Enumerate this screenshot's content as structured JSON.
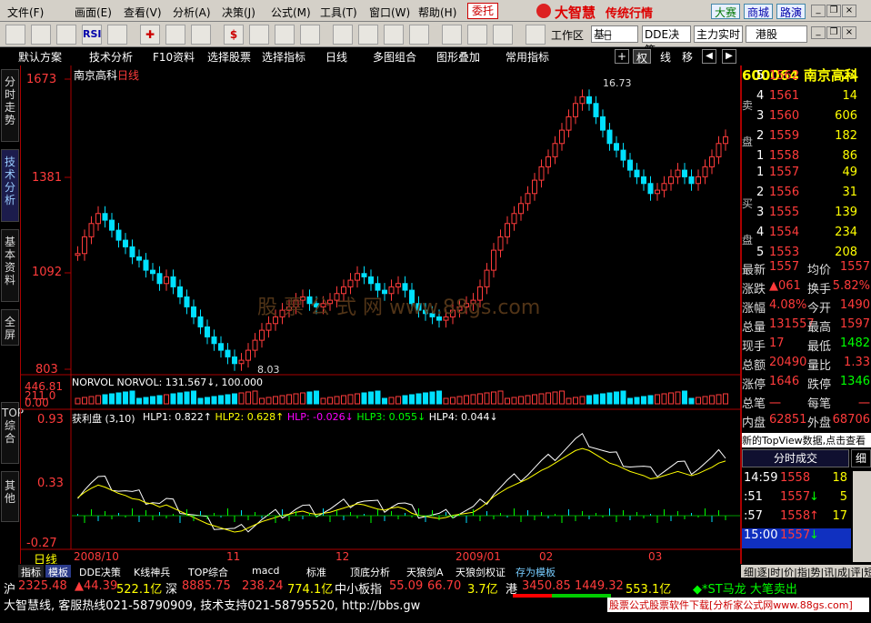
{
  "menu": {
    "items": [
      "文件(F)",
      "画面(E)",
      "查看(V)",
      "分析(A)",
      "决策(J)",
      "公式(M)",
      "工具(T)",
      "窗口(W)",
      "帮助(H)"
    ],
    "weituo": "委托",
    "brand": "大智慧",
    "brand_sub": "传统行情",
    "dasai": "大赛",
    "shangcheng": "商城",
    "luyou": "路演"
  },
  "toolbar": {
    "workspace": "工作区",
    "basic": "基本̶",
    "dde": "DDE决策",
    "main_live": "主力实时",
    "hk": "港股"
  },
  "tabs": [
    "默认方案",
    "技术分析",
    "F10资料",
    "选择股票",
    "选择指标",
    "日线",
    "多图组合",
    "图形叠加",
    "常用指标"
  ],
  "tab_right": {
    "right_tab": "权",
    "line": "线",
    "move": "移"
  },
  "left_tabs": [
    "分时走势",
    "技术分析",
    "基本资料",
    "全屏",
    "TOP综合",
    "其他"
  ],
  "chart": {
    "stock_name": "南京高科",
    "period": "日线",
    "price_axis": [
      "1673",
      "1381",
      "1092",
      "803"
    ],
    "high_label": "16.73",
    "low_label": "8.03",
    "vol_title": "NORVOL  NORVOL: 131.567↓, 100.000",
    "vol_axis": [
      "446.81",
      "211.0",
      "0.00"
    ],
    "ind_title": "获利盘 (3,10)",
    "ind_values": [
      {
        "label": "HLP1: 0.822↑",
        "color": "#ffffff"
      },
      {
        "label": "HLP2: 0.628↑",
        "color": "#ffff00"
      },
      {
        "label": "HLP: -0.026↓",
        "color": "#ff00ff"
      },
      {
        "label": "HLP3: 0.055↓",
        "color": "#00ff00"
      },
      {
        "label": "HLP4: 0.044↓",
        "color": "#ffffff"
      }
    ],
    "ind_axis": [
      "0.93",
      "0.33",
      "-0.27"
    ],
    "date_labels": [
      "2008/10",
      "11",
      "12",
      "2009/01",
      "02",
      "03"
    ],
    "period_tab": "日线",
    "watermark": "股 票 公 式 网 www.88gs.com"
  },
  "quote": {
    "code": "600064",
    "name": "南京高科",
    "sell_label": "卖盘",
    "buy_label": "买盘",
    "asks": [
      {
        "lvl": "5",
        "price": "1562",
        "vol": "24"
      },
      {
        "lvl": "4",
        "price": "1561",
        "vol": "14"
      },
      {
        "lvl": "3",
        "price": "1560",
        "vol": "606"
      },
      {
        "lvl": "2",
        "price": "1559",
        "vol": "182"
      },
      {
        "lvl": "1",
        "price": "1558",
        "vol": "86"
      }
    ],
    "bids": [
      {
        "lvl": "1",
        "price": "1557",
        "vol": "49"
      },
      {
        "lvl": "2",
        "price": "1556",
        "vol": "31"
      },
      {
        "lvl": "3",
        "price": "1555",
        "vol": "139"
      },
      {
        "lvl": "4",
        "price": "1554",
        "vol": "234"
      },
      {
        "lvl": "5",
        "price": "1553",
        "vol": "208"
      }
    ],
    "stats": [
      {
        "l": "最新",
        "v": "1557",
        "l2": "均价",
        "v2": "1557"
      },
      {
        "l": "涨跌",
        "v": "▲061",
        "l2": "换手",
        "v2": "5.82%"
      },
      {
        "l": "涨幅",
        "v": "4.08%",
        "l2": "今开",
        "v2": "1490"
      },
      {
        "l": "总量",
        "v": "131557",
        "l2": "最高",
        "v2": "1597"
      },
      {
        "l": "现手",
        "v": "17",
        "l2": "最低",
        "v2": "1482"
      },
      {
        "l": "总额",
        "v": "20490",
        "l2": "量比",
        "v2": "1.33"
      },
      {
        "l": "涨停",
        "v": "1646",
        "l2": "跌停",
        "v2": "1346"
      },
      {
        "l": "总笔",
        "v": "一",
        "l2": "每笔",
        "v2": "一"
      },
      {
        "l": "内盘",
        "v": "62851",
        "l2": "外盘",
        "v2": "68706"
      }
    ],
    "topview": "新的TopView数据,点击查看",
    "ticks_tab": "分时成交",
    "detail_tab": "细",
    "ticks": [
      {
        "t": "14:59",
        "p": "1558",
        "v": "18",
        "dir": ""
      },
      {
        "t": ":51",
        "p": "1557",
        "v": "5",
        "dir": "↓"
      },
      {
        "t": ":57",
        "p": "1558",
        "v": "17",
        "dir": "↑"
      },
      {
        "t": "15:00",
        "p": "1557",
        "v": "",
        "dir": "↓"
      }
    ]
  },
  "bottom_tabs": [
    "指标",
    "模板",
    "DDE决策",
    "K线神兵",
    "TOP综合",
    "macd",
    "标准",
    "顶底分析",
    "天狼剑A",
    "天狼剑权证",
    "存为模板"
  ],
  "right_bottom_tabs": "细|逐|时|价|指|势|讯|成|评|短",
  "status": {
    "sh": "沪",
    "sh_idx": "2325.48",
    "sh_chg": "▲44.39",
    "sh_amt": "522.1亿",
    "sz": "深",
    "sz_idx": "8885.75",
    "sz_chg": "238.24",
    "sz_amt": "774.1亿",
    "zx": "中小板指",
    "zx_idx": "55.09",
    "zx_chg": "66.70",
    "zx_amt": "3.7亿",
    "hk": "港",
    "hk_idx": "3450.85",
    "hk_chg": "1449.32",
    "hk_amt": "553.1亿",
    "ticker": "◆*ST马龙 大笔卖出",
    "line2": "大智慧线, 客服热线021-58790909, 技术支持021-58795520, http://bbs.gw",
    "ad": "股票公式股票软件下载[分析家公式网www.88gs.com]"
  }
}
